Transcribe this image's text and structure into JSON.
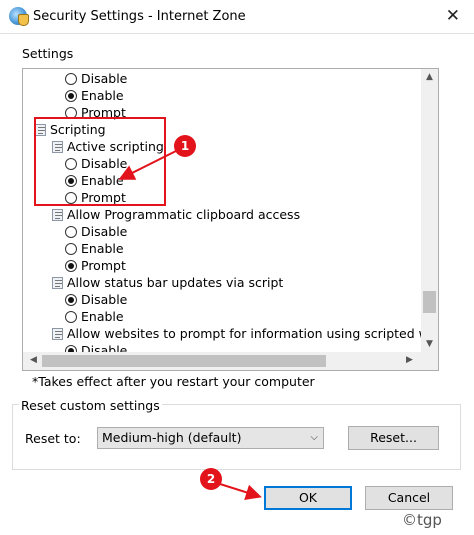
{
  "window": {
    "title": "Security Settings - Internet Zone",
    "close_glyph": "✕"
  },
  "settings_label": "Settings",
  "tree": [
    {
      "type": "radio",
      "label": "Disable",
      "checked": false,
      "level": 2
    },
    {
      "type": "radio",
      "label": "Enable",
      "checked": true,
      "level": 2
    },
    {
      "type": "radio",
      "label": "Prompt",
      "checked": false,
      "level": 2
    },
    {
      "type": "group",
      "label": "Scripting",
      "level": 0
    },
    {
      "type": "group",
      "label": "Active scripting",
      "level": 1
    },
    {
      "type": "radio",
      "label": "Disable",
      "checked": false,
      "level": 2
    },
    {
      "type": "radio",
      "label": "Enable",
      "checked": true,
      "level": 2
    },
    {
      "type": "radio",
      "label": "Prompt",
      "checked": false,
      "level": 2
    },
    {
      "type": "group",
      "label": "Allow Programmatic clipboard access",
      "level": 1
    },
    {
      "type": "radio",
      "label": "Disable",
      "checked": false,
      "level": 2
    },
    {
      "type": "radio",
      "label": "Enable",
      "checked": false,
      "level": 2
    },
    {
      "type": "radio",
      "label": "Prompt",
      "checked": true,
      "level": 2
    },
    {
      "type": "group",
      "label": "Allow status bar updates via script",
      "level": 1
    },
    {
      "type": "radio",
      "label": "Disable",
      "checked": true,
      "level": 2
    },
    {
      "type": "radio",
      "label": "Enable",
      "checked": false,
      "level": 2
    },
    {
      "type": "group",
      "label": "Allow websites to prompt for information using scripted windows",
      "level": 1
    },
    {
      "type": "radio",
      "label": "Disable",
      "checked": true,
      "level": 2
    }
  ],
  "scroll_glyphs": {
    "up": "▲",
    "down": "▼",
    "left": "◀",
    "right": "▶"
  },
  "note": "*Takes effect after you restart your computer",
  "reset": {
    "group_label": "Reset custom settings",
    "reset_to_label": "Reset to:",
    "selected": "Medium-high (default)",
    "chevron": "⌵",
    "reset_button": "Reset..."
  },
  "buttons": {
    "ok": "OK",
    "cancel": "Cancel"
  },
  "annotations": {
    "badge1": "1",
    "badge2": "2",
    "color": "#e3131b"
  },
  "watermark": "©tgp"
}
